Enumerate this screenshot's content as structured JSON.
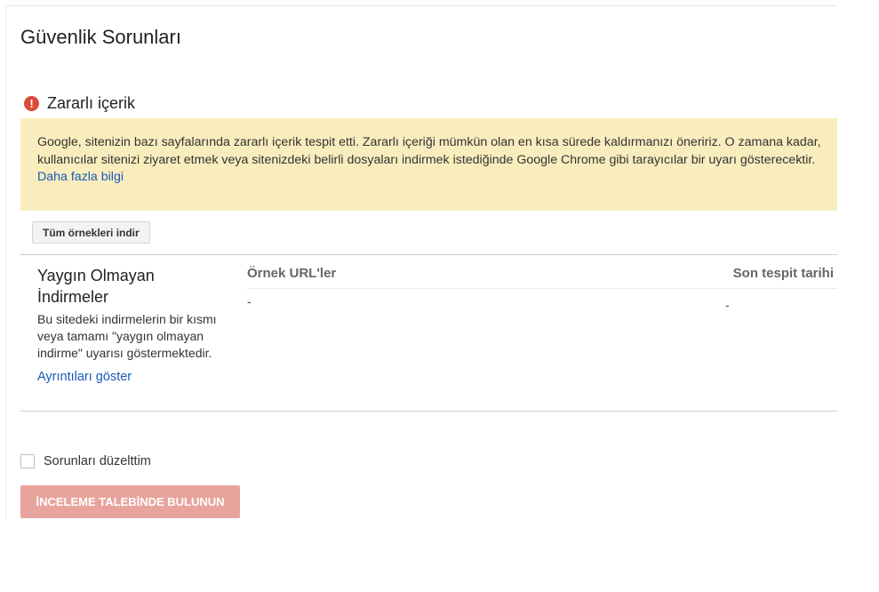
{
  "page": {
    "title": "Güvenlik Sorunları"
  },
  "section": {
    "icon": "alert-circle-icon",
    "icon_glyph": "!",
    "icon_color": "#dd4b39",
    "title": "Zararlı içerik"
  },
  "warning": {
    "text": "Google, sitenizin bazı sayfalarında zararlı içerik tespit etti. Zararlı içeriği mümkün olan en kısa sürede kaldırmanızı öneririz. O zamana kadar, kullanıcılar sitenizi ziyaret etmek veya sitenizdeki belirli dosyaları indirmek istediğinde Google Chrome gibi tarayıcılar bir uyarı gösterecektir. ",
    "link": "Daha fazla bilgi",
    "background": "#f9edbe"
  },
  "actions": {
    "download_all": "Tüm örnekleri indir"
  },
  "issue": {
    "title": "Yaygın Olmayan İndirmeler",
    "description": "Bu sitedeki indirmelerin bir kısmı veya tamamı \"yaygın olmayan indirme\" uyarısı göstermektedir.",
    "details_link": "Ayrıntıları göster",
    "columns": {
      "urls": "Örnek URL'ler",
      "date": "Son tespit tarihi"
    },
    "rows": [
      {
        "url": "-",
        "date": "-"
      }
    ]
  },
  "fixed": {
    "checkbox_label": "Sorunları düzelttim",
    "checked": false
  },
  "review": {
    "button_label": "İNCELEME TALEBİNDE BULUNUN",
    "enabled": false,
    "color": "#e8a49c"
  },
  "colors": {
    "link": "#1a5ab8"
  }
}
